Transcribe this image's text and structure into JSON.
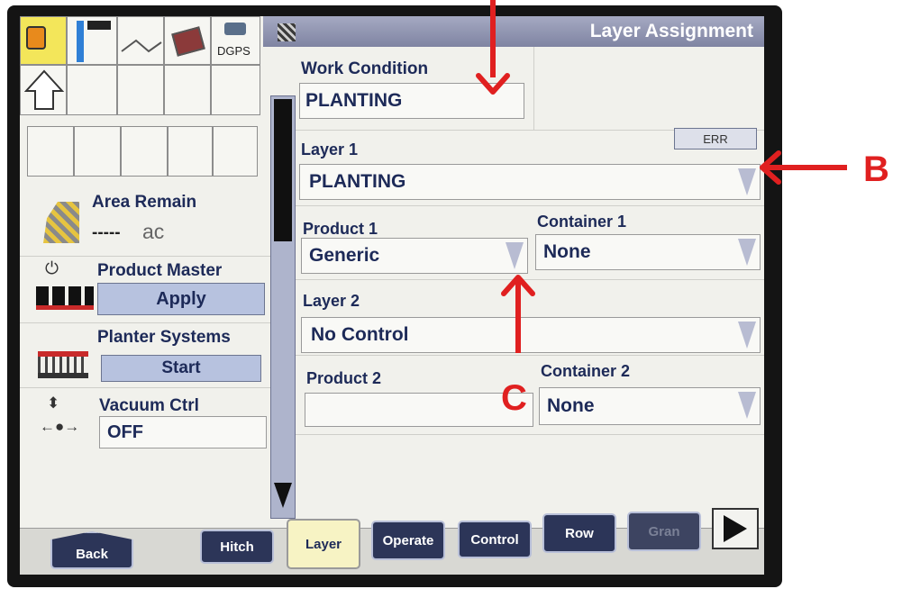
{
  "title": "Layer Assignment",
  "status_bar": {
    "dgps_label": "DGPS"
  },
  "area": {
    "label": "Area Remain",
    "value": "-----",
    "unit": "ac"
  },
  "product_master": {
    "label": "Product Master",
    "button": "Apply"
  },
  "planter_systems": {
    "label": "Planter Systems",
    "button": "Start"
  },
  "vacuum": {
    "label": "Vacuum Ctrl",
    "value": "OFF"
  },
  "work_condition": {
    "label": "Work Condition",
    "value": "PLANTING"
  },
  "err_button": "ERR",
  "layer1": {
    "label": "Layer 1",
    "value": "PLANTING"
  },
  "product1": {
    "label": "Product 1",
    "value": "Generic"
  },
  "container1": {
    "label": "Container 1",
    "value": "None"
  },
  "layer2": {
    "label": "Layer 2",
    "value": "No Control"
  },
  "product2": {
    "label": "Product 2",
    "value": ""
  },
  "container2": {
    "label": "Container 2",
    "value": "None"
  },
  "tabs": {
    "back": "Back",
    "hitch": "Hitch",
    "layer": "Layer",
    "operate": "Operate",
    "control": "Control",
    "row": "Row",
    "gran": "Gran"
  },
  "annotations": {
    "b": "B",
    "c": "C"
  },
  "colors": {
    "title_bar": "#8c91ad",
    "tab_dark": "#2c3558",
    "button_blue": "#b7c2df",
    "arrow_red": "#e02020",
    "label_navy": "#1d2a58"
  }
}
